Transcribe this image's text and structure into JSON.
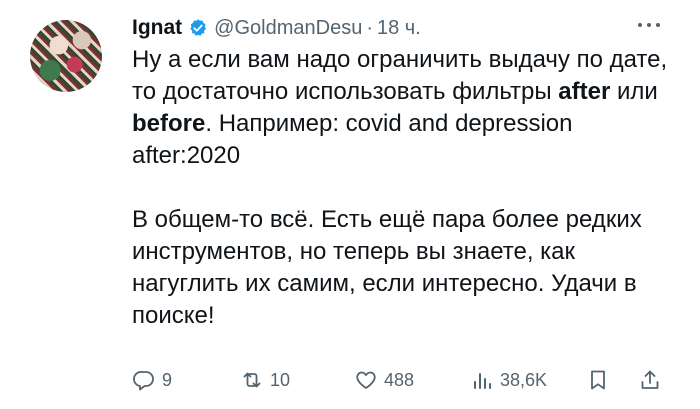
{
  "tweet": {
    "author_name": "Ignat",
    "handle": "@GoldmanDesu",
    "separator": "·",
    "time": "18 ч.",
    "para1": {
      "t1": "Ну а если вам надо ограничить выдачу по дате, то достаточно использовать фильтры ",
      "b1": "after",
      "t2": " или ",
      "b2": "before",
      "t3": ". Например: covid and depression after:2020"
    },
    "para2": "В общем-то всё. Есть ещё пара более редких инструментов, но теперь вы знаете, как нагуглить их самим, если интересно. Удачи в поиске!"
  },
  "actions": {
    "replies": "9",
    "reposts": "10",
    "likes": "488",
    "views": "38,6K"
  },
  "colors": {
    "verified_badge": "#1d9bf0",
    "secondary_text": "#536471",
    "primary_text": "#0f1419"
  },
  "icons": [
    "verified-badge-icon",
    "more-icon",
    "reply-icon",
    "repost-icon",
    "like-icon",
    "views-icon",
    "bookmark-icon",
    "share-icon"
  ]
}
